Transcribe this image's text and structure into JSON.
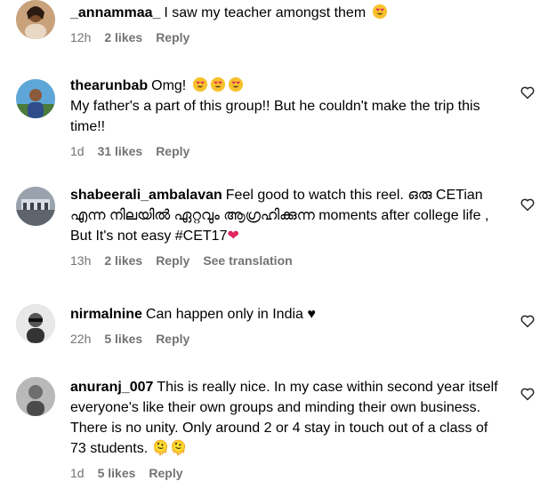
{
  "comments": [
    {
      "username": "_annammaa_",
      "text": "I saw my teacher amongst them",
      "emoji_count": 1,
      "time": "12h",
      "likes": "2 likes",
      "reply": "Reply"
    },
    {
      "username": "thearunbab",
      "text": "Omg!",
      "emoji_count": 3,
      "text2": "My father's a part of this group!! But he couldn't make the trip this time!!",
      "time": "1d",
      "likes": "31 likes",
      "reply": "Reply"
    },
    {
      "username": "shabeerali_ambalavan",
      "text": "Feel good to watch this reel. ഒരു CETian എന്ന നിലയിൽ ഏറ്റവും ആഗ്രഹിക്കുന്ന moments after college life , But It's not easy #CET17",
      "trailing_symbol": "❤",
      "time": "13h",
      "likes": "2 likes",
      "reply": "Reply",
      "see_translation": "See translation"
    },
    {
      "username": "nirmalnine",
      "text": "Can happen only in India",
      "trailing_symbol": "♥",
      "time": "22h",
      "likes": "5 likes",
      "reply": "Reply"
    },
    {
      "username": "anuranj_007",
      "text": "This is really nice. In my case within second year itself everyone's like their own groups and minding their own business. There is no unity. Only around 2 or 4 stay in touch out of a class of 73 students. 🫠🫠",
      "time": "1d",
      "likes": "5 likes",
      "reply": "Reply"
    }
  ],
  "icons": {
    "like": "heart-outline-icon",
    "emoji": "heart-eyes-emoji"
  },
  "colors": {
    "meta": "#737373",
    "emoji_face": "#f7c22c",
    "emoji_heart": "#e0245e"
  }
}
